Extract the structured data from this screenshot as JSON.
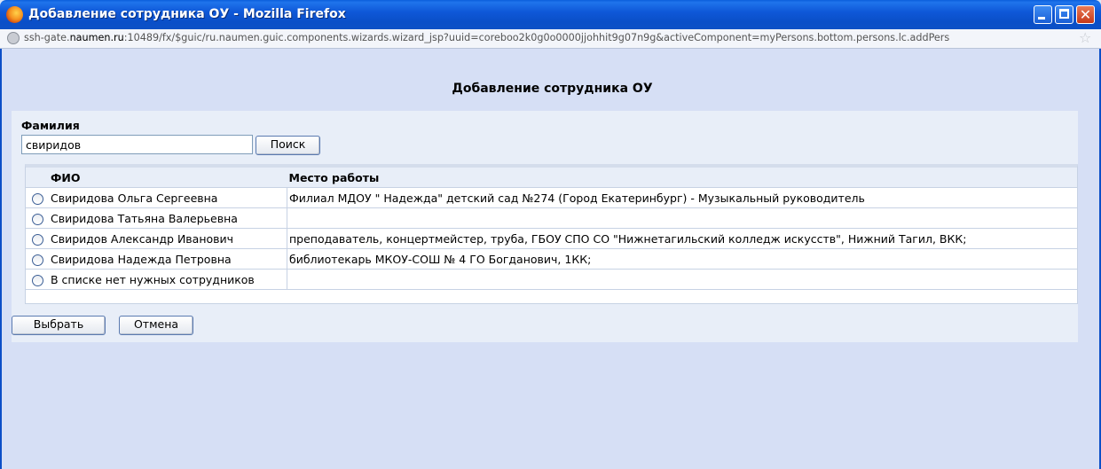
{
  "window": {
    "title": "Добавление сотрудника ОУ - Mozilla Firefox",
    "app_icon": "firefox-icon"
  },
  "address_bar": {
    "url_prefix": "ssh-gate.",
    "url_host": "naumen.ru",
    "url_rest": ":10489/fx/$guic/ru.naumen.guic.components.wizards.wizard_jsp?uuid=coreboo2k0g0o0000jjohhit9g07n9g&activeComponent=myPersons.bottom.persons.lc.addPers"
  },
  "page": {
    "title": "Добавление сотрудника ОУ"
  },
  "search": {
    "label": "Фамилия",
    "value": "свиридов",
    "button_label": "Поиск"
  },
  "results": {
    "columns": [
      "ФИО",
      "Место работы"
    ],
    "rows": [
      {
        "name": "Свиридова Ольга Сергеевна",
        "workplace": "Филиал МДОУ \" Надежда\" детский сад №274 (Город Екатеринбург) - Музыкальный руководитель"
      },
      {
        "name": "Свиридова Татьяна Валерьевна",
        "workplace": ""
      },
      {
        "name": "Свиридов Александр Иванович",
        "workplace": "преподаватель, концертмейстер, труба, ГБОУ СПО СО \"Нижнетагильский колледж искусств\", Нижний Тагил, ВКК;"
      },
      {
        "name": "Свиридова Надежда Петровна",
        "workplace": "библиотекарь МКОУ-СОШ № 4 ГО Богданович, 1КК;"
      },
      {
        "name": "В списке нет нужных сотрудников",
        "workplace": ""
      }
    ]
  },
  "actions": {
    "select_label": "Выбрать",
    "cancel_label": "Отмена"
  }
}
